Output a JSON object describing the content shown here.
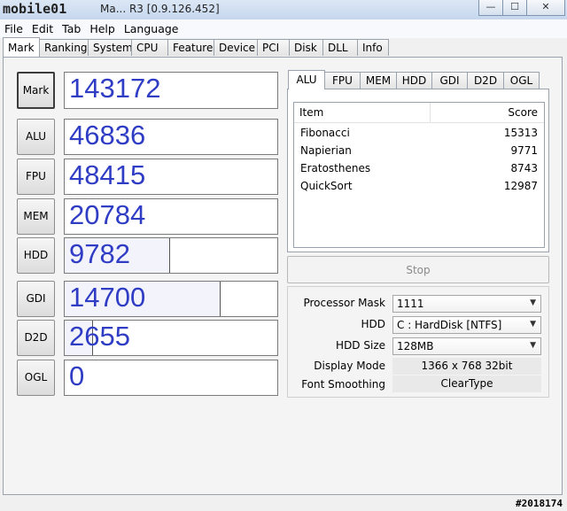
{
  "window": {
    "logo_text": "mobile01",
    "title": "Ma... R3 [0.9.126.452]",
    "minimize_glyph": "—",
    "maximize_glyph": "☐",
    "close_glyph": "✕"
  },
  "menu": [
    "File",
    "Edit",
    "Tab",
    "Help",
    "Language"
  ],
  "tabs": [
    {
      "label": "Mark",
      "active": true
    },
    {
      "label": "Ranking"
    },
    {
      "label": "System"
    },
    {
      "label": "CPU"
    },
    {
      "label": "Feature"
    },
    {
      "label": "Device"
    },
    {
      "label": "PCI"
    },
    {
      "label": "Disk"
    },
    {
      "label": "DLL"
    },
    {
      "label": "Info"
    }
  ],
  "scores": [
    {
      "label": "Mark",
      "value": "143172",
      "fill_fraction": 1.0
    },
    {
      "label": "ALU",
      "value": "46836",
      "fill_fraction": 1.0
    },
    {
      "label": "FPU",
      "value": "48415",
      "fill_fraction": 1.0
    },
    {
      "label": "MEM",
      "value": "20784",
      "fill_fraction": 1.0
    },
    {
      "label": "HDD",
      "value": "9782",
      "fill_fraction": 0.49
    },
    {
      "label": "GDI",
      "value": "14700",
      "fill_fraction": 0.73
    },
    {
      "label": "D2D",
      "value": "2655",
      "fill_fraction": 0.13
    },
    {
      "label": "OGL",
      "value": "0",
      "fill_fraction": 0.0
    }
  ],
  "subtabs": [
    {
      "label": "ALU",
      "active": true
    },
    {
      "label": "FPU"
    },
    {
      "label": "MEM"
    },
    {
      "label": "HDD"
    },
    {
      "label": "GDI"
    },
    {
      "label": "D2D"
    },
    {
      "label": "OGL"
    }
  ],
  "alu_table": {
    "headers": [
      "Item",
      "Score"
    ],
    "rows": [
      [
        "Fibonacci",
        "15313"
      ],
      [
        "Napierian",
        "9771"
      ],
      [
        "Eratosthenes",
        "8743"
      ],
      [
        "QuickSort",
        "12987"
      ]
    ]
  },
  "stop_label": "Stop",
  "settings": {
    "processor_mask_label": "Processor Mask",
    "processor_mask_value": "1111",
    "hdd_label": "HDD",
    "hdd_value": "C : HardDisk [NTFS]",
    "hdd_size_label": "HDD Size",
    "hdd_size_value": "128MB",
    "display_mode_label": "Display Mode",
    "display_mode_value": "1366 x 768 32bit",
    "font_smoothing_label": "Font Smoothing",
    "font_smoothing_value": "ClearType"
  },
  "watermark": "#2018174",
  "colors": {
    "score_text": "#2f3cc4",
    "fill": "#f3f3fc"
  }
}
